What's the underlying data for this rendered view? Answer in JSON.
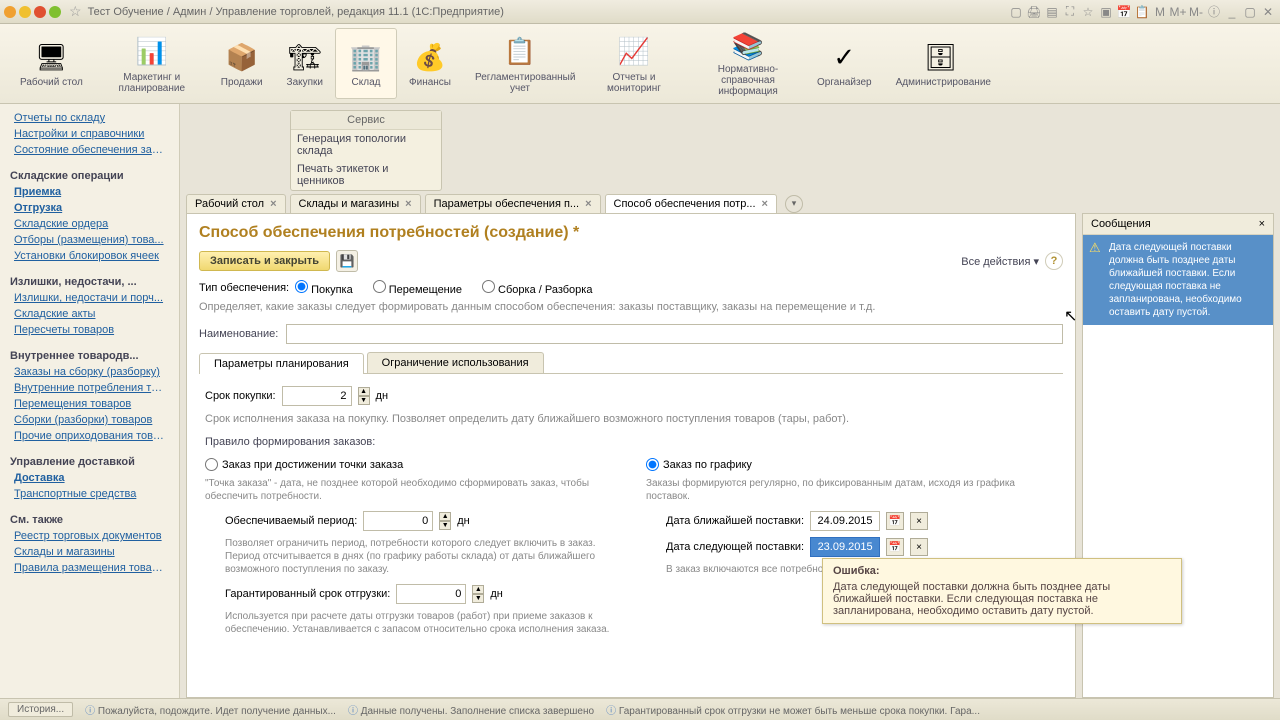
{
  "titlebar": {
    "title": "Тест Обучение / Админ / Управление торговлей, редакция 11.1  (1С:Предприятие)"
  },
  "toolbar": {
    "items": [
      {
        "label": "Рабочий\nстол",
        "icon": "🖥"
      },
      {
        "label": "Маркетинг и\nпланирование",
        "icon": "📊"
      },
      {
        "label": "Продажи",
        "icon": "📦"
      },
      {
        "label": "Закупки",
        "icon": "🏗"
      },
      {
        "label": "Склад",
        "icon": "🏢"
      },
      {
        "label": "Финансы",
        "icon": "💰"
      },
      {
        "label": "Регламентированный\nучет",
        "icon": "📋"
      },
      {
        "label": "Отчеты и\nмониторинг",
        "icon": "📈"
      },
      {
        "label": "Нормативно-справочная\nинформация",
        "icon": "📚"
      },
      {
        "label": "Органайзер",
        "icon": "✓"
      },
      {
        "label": "Администрирование",
        "icon": "🗄"
      }
    ]
  },
  "service": {
    "title": "Сервис",
    "items": [
      "Генерация топологии склада",
      "Печать этикеток и ценников"
    ]
  },
  "leftnav": {
    "g0": [
      "Отчеты по складу",
      "Настройки и справочники",
      "Состояние обеспечения зака..."
    ],
    "g1_title": "Складские операции",
    "g1": [
      "Приемка",
      "Отгрузка",
      "Складские ордера",
      "Отборы (размещения) това...",
      "Установки блокировок ячеек"
    ],
    "g2_title": "Излишки, недостачи, ...",
    "g2": [
      "Излишки, недостачи и порч...",
      "Складские акты",
      "Пересчеты товаров"
    ],
    "g3_title": "Внутреннее товародв...",
    "g3": [
      "Заказы на сборку (разборку)",
      "Внутренние потребления то...",
      "Перемещения товаров",
      "Сборки (разборки) товаров",
      "Прочие оприходования това..."
    ],
    "g4_title": "Управление доставкой",
    "g4": [
      "Доставка",
      "Транспортные средства"
    ],
    "g5_title": "См. также",
    "g5": [
      "Реестр торговых документов",
      "Склады и магазины",
      "Правила размещения товаров"
    ]
  },
  "tabs": [
    {
      "label": "Рабочий стол"
    },
    {
      "label": "Склады и магазины"
    },
    {
      "label": "Параметры обеспечения п..."
    },
    {
      "label": "Способ обеспечения потр..."
    }
  ],
  "form": {
    "title": "Способ обеспечения потребностей (создание) *",
    "save_close": "Записать и закрыть",
    "all_actions": "Все действия ▾",
    "type_label": "Тип обеспечения:",
    "radio1": "Покупка",
    "radio2": "Перемещение",
    "radio3": "Сборка / Разборка",
    "hint1": "Определяет, какие заказы следует формировать данным способом обеспечения: заказы поставщику, заказы на перемещение и т.д.",
    "name_label": "Наименование:",
    "name_value": "",
    "subtab1": "Параметры планирования",
    "subtab2": "Ограничение использования",
    "term_label": "Срок покупки:",
    "term_value": "2",
    "term_unit": "дн",
    "term_hint": "Срок исполнения заказа на покупку. Позволяет определить дату ближайшего возможного поступления товаров (тары, работ).",
    "rule_label": "Правило формирования заказов:",
    "rule_r1": "Заказ при достижении точки заказа",
    "rule_r2": "Заказ по графику",
    "col1_hint1": "\"Точка заказа\" - дата, не позднее которой необходимо сформировать заказ, чтобы обеспечить потребности.",
    "col1_label1": "Обеспечиваемый период:",
    "col1_val1": "0",
    "col1_hint2": "Позволяет ограничить период, потребности которого следует включить в заказ. Период отсчитывается в днях (по графику работы склада) от даты ближайшего возможного поступления по заказу.",
    "col1_label2": "Гарантированный срок отгрузки:",
    "col1_val2": "0",
    "col1_hint3": "Используется при расчете даты отгрузки товаров (работ) при приеме заказов к обеспечению. Устанавливается с запасом относительно срока исполнения заказа.",
    "col2_hint1": "Заказы формируются регулярно, по фиксированным датам, исходя из графика поставок.",
    "col2_label1": "Дата ближайшей поставки:",
    "col2_val1": "24.09.2015",
    "col2_label2": "Дата следующей поставки:",
    "col2_val2": "23.09.2015",
    "col2_hint2": "В заказ включаются все потребности до даты следующей поставки.",
    "unit_dn": "дн"
  },
  "messages": {
    "title": "Сообщения",
    "msg1": "Дата следующей поставки должна быть позднее даты ближайшей поставки.\n Если следующая поставка не запланирована, необходимо оставить дату пустой."
  },
  "tooltip": {
    "header": "Ошибка:",
    "body": "Дата следующей поставки должна быть позднее даты ближайшей поставки.\n Если следующая поставка не запланирована, необходимо оставить дату пустой."
  },
  "statusbar": {
    "history": "История...",
    "s1": "Пожалуйста, подождите. Идет получение данных...",
    "s2": "Данные получены. Заполнение списка завершено",
    "s3": "Гарантированный срок отгрузки не может быть меньше срока покупки. Гара..."
  }
}
